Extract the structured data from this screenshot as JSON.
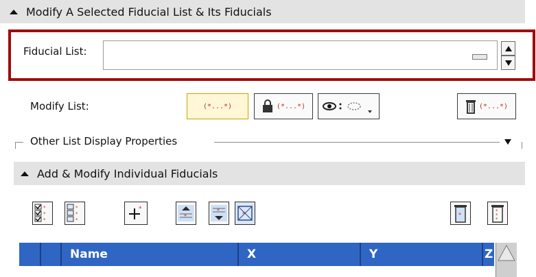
{
  "section1": {
    "title": "Modify A Selected Fiducial List & Its Fiducials"
  },
  "fiducial_list": {
    "label": "Fiducial List:",
    "value": ""
  },
  "modify_list": {
    "label": "Modify List:",
    "bracket_text": "(*...*)"
  },
  "other_display": {
    "label": "Other List Display Properties"
  },
  "section2": {
    "title": "Add & Modify Individual Fiducials"
  },
  "table": {
    "columns": [
      "Name",
      "X",
      "Y",
      "Z"
    ]
  },
  "colors": {
    "accent_red": "#a10b0b",
    "header_blue": "#2f66c4"
  }
}
